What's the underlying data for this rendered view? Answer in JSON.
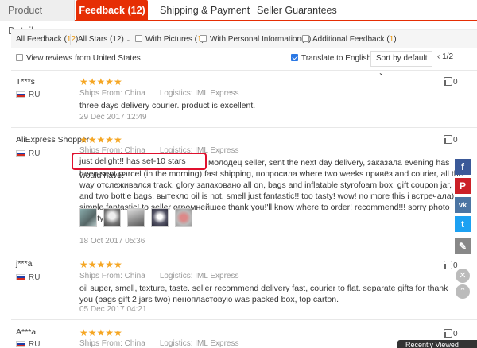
{
  "tabs": [
    {
      "label": "Product Details"
    },
    {
      "label": "Feedback (12)"
    },
    {
      "label": "Shipping & Payment"
    },
    {
      "label": "Seller Guarantees"
    }
  ],
  "filter": {
    "all_feedback": "All Feedback (",
    "all_feedback_count": "12",
    "all_feedback_close": ")",
    "all_stars": "All Stars (12)",
    "with_pictures": "With Pictures (",
    "with_pictures_count": "1",
    "with_personal": "With Personal Information(",
    "with_personal_count": "0",
    "additional": "Additional Feedback (",
    "additional_count": "1",
    "close": ")"
  },
  "options": {
    "view_us": "View reviews from United States",
    "translate": "Translate to English",
    "sort": "Sort by default",
    "pager": "1/2"
  },
  "reviews": [
    {
      "name": "T***s",
      "country": "RU",
      "stars": "★★★★★",
      "ships": "Ships From: China",
      "logistics": "Logistics: IML Express",
      "text": "three days delivery courier. product is excellent.",
      "date": "29 Dec 2017 12:49",
      "helpful": "0"
    },
    {
      "name": "AliExpress Shopper",
      "country": "RU",
      "stars": "★★★★★",
      "ships": "Ships From: China",
      "logistics": "Logistics: IML Express",
      "highlight": "just delight!! has set-10 stars would have!",
      "text": "молодец seller, sent the next day delivery, заказала evening has been sent parcel (in the morning) fast shipping, попросила where two weeks привёз and courier, all the way отслеживался track. glory запаковано all on, bags and inflatable styrofoam box. gift coupon jar, and two bottle bags. вытекло oil is not. smell just fantastic!! too tasty! wow! no more this i встречала) simple fantastic! to seller огромнейшее thank you!'ll know where to order! recommend!!! sorry photo quality ((",
      "date": "18 Oct 2017 05:36",
      "helpful": "0"
    },
    {
      "name": "j***a",
      "country": "RU",
      "stars": "★★★★★",
      "ships": "Ships From: China",
      "logistics": "Logistics: IML Express",
      "text": "oil super, smell, texture, taste. seller recommend delivery fast, courier to flat. separate gifts for thank you (bags gift 2 jars two) пенопластовую was packed box, top carton.",
      "date": "05 Dec 2017 04:21",
      "helpful": "0"
    },
    {
      "name": "A***a",
      "country": "RU",
      "stars": "★★★★★",
      "ships": "Ships From: China",
      "logistics": "Logistics: IML Express",
      "helpful": "0"
    }
  ],
  "share": {
    "facebook": "f",
    "pinterest": "P",
    "vk": "vk",
    "twitter": "t",
    "edit": "✎",
    "close": "✕",
    "up": "⌃",
    "colors": {
      "facebook": "#3b5998",
      "pinterest": "#cb2027",
      "vk": "#4c75a3",
      "twitter": "#1da1f2",
      "edit": "#888888"
    }
  },
  "recently": "Recently Viewed"
}
